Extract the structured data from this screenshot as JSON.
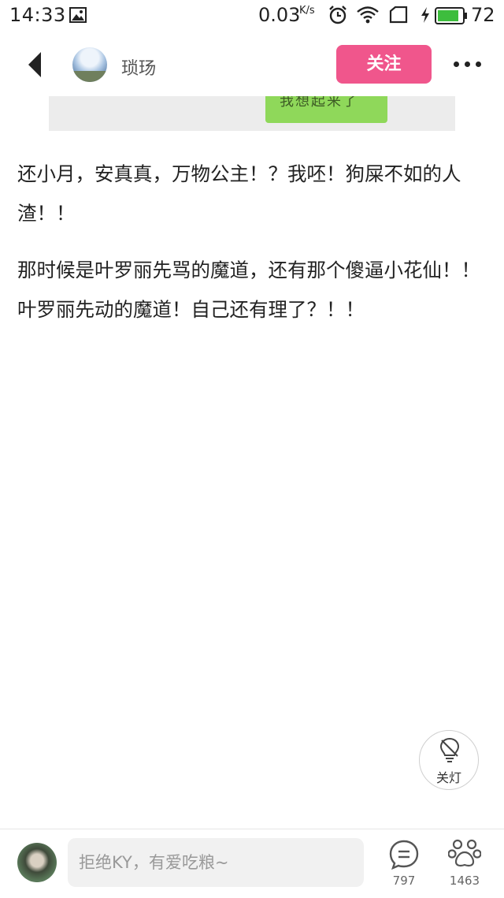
{
  "status_bar": {
    "time": "14:33",
    "network_speed": "0.03",
    "speed_unit": "K/s",
    "battery_level": "72",
    "icons": [
      "image-icon",
      "alarm-icon",
      "wifi-icon",
      "sim-icon",
      "charging-icon",
      "battery-icon"
    ]
  },
  "header": {
    "username": "琐玚",
    "follow_label": "关注"
  },
  "article": {
    "image_caption": "我想起来了",
    "paragraphs": [
      "还小月，安真真，万物公主！？我呸！狗屎不如的人渣！！",
      "那时候是叶罗丽先骂的魔道，还有那个傻逼小花仙！！叶罗丽先动的魔道！自己还有理了？！！"
    ]
  },
  "light_toggle": {
    "label": "关灯"
  },
  "bottom_bar": {
    "comment_placeholder": "拒绝KY，有爱吃粮~",
    "comment_count": "797",
    "like_count": "1463"
  },
  "colors": {
    "follow_button": "#f0568c",
    "image_green": "#8fd85a"
  }
}
